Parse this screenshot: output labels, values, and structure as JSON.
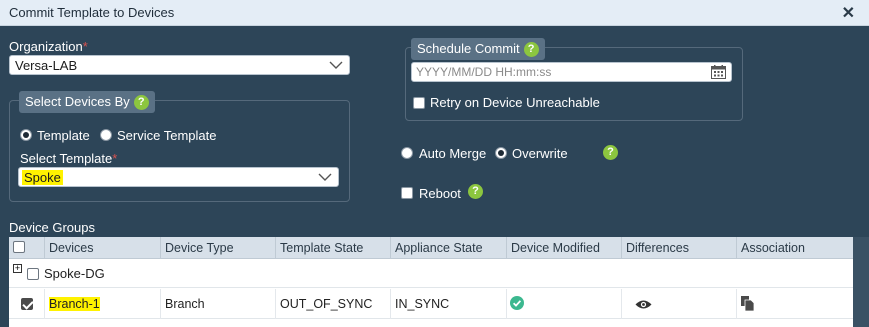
{
  "dialog": {
    "title": "Commit Template to Devices",
    "close_glyph": "✕"
  },
  "organization": {
    "label": "Organization",
    "required_mark": "*",
    "value": "Versa-LAB"
  },
  "select_devices_by": {
    "legend": "Select Devices By",
    "help_glyph": "?",
    "options": [
      {
        "label": "Template",
        "selected": true
      },
      {
        "label": "Service Template",
        "selected": false
      }
    ],
    "template_label": "Select Template",
    "required_mark": "*",
    "template_value": "Spoke"
  },
  "schedule_commit": {
    "legend": "Schedule Commit",
    "help_glyph": "?",
    "placeholder": "YYYY/MM/DD HH:mm:ss",
    "retry_label": "Retry on Device Unreachable",
    "retry_checked": false
  },
  "merge": {
    "options": [
      {
        "label": "Auto Merge",
        "selected": false
      },
      {
        "label": "Overwrite",
        "selected": true
      }
    ],
    "help_glyph": "?"
  },
  "reboot": {
    "label": "Reboot",
    "checked": false,
    "help_glyph": "?"
  },
  "device_groups": {
    "label": "Device Groups",
    "columns": [
      "Devices",
      "Device Type",
      "Template State",
      "Appliance State",
      "Device Modified",
      "Differences",
      "Association"
    ],
    "group": {
      "expand_glyph": "+",
      "name": "Spoke-DG",
      "checked": false
    },
    "rows": [
      {
        "checked": true,
        "device": "Branch-1",
        "device_type": "Branch",
        "template_state": "OUT_OF_SYNC",
        "appliance_state": "IN_SYNC",
        "device_modified_icon": "check-circle-icon",
        "differences_icon": "eye-icon",
        "association_icon": "documents-icon"
      }
    ]
  },
  "colors": {
    "background": "#2d4558",
    "title_bar": "#e4edf6",
    "legend": "#5a7185",
    "help": "#8cc63f",
    "success": "#3cb88f",
    "highlight": "#fff200",
    "required": "#d9534f"
  }
}
